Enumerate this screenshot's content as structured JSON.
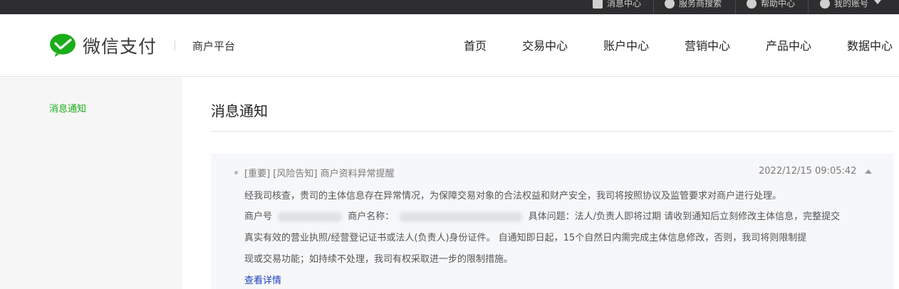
{
  "topbar": {
    "items": [
      {
        "label": "消息中心",
        "icon": "message-icon"
      },
      {
        "label": "服务商搜索",
        "icon": "search-icon"
      },
      {
        "label": "帮助中心",
        "icon": "help-icon"
      },
      {
        "label": "我的账号",
        "icon": "user-icon"
      }
    ]
  },
  "header": {
    "logo_text": "微信支付",
    "platform": "商户平台",
    "nav": [
      "首页",
      "交易中心",
      "账户中心",
      "营销中心",
      "产品中心",
      "数据中心"
    ]
  },
  "sidebar": {
    "items": [
      {
        "label": "消息通知",
        "active": true
      }
    ]
  },
  "main": {
    "title": "消息通知",
    "message": {
      "tag_important": "[重要]",
      "tag_risk": "[风险告知]",
      "subject": "商户资料异常提醒",
      "time": "2022/12/15 09:05:42",
      "line1": "经我司核查，贵司的主体信息存在异常情况，为保障交易对象的合法权益和财产安全，我司将按照协议及监管要求对商户进行处理。",
      "merchant_no_label": "商户号",
      "merchant_name_label": "商户名称：",
      "issue_text": "具体问题：法人/负责人即将过期 请收到通知后立刻修改主体信息，完整提交",
      "line3": "真实有效的营业执照/经营登记证书或法人(负责人)身份证件。 自通知即日起，15个自然日内需完成主体信息修改，否则，我司将则限制提",
      "line4": "现或交易功能；如持续不处理，我司有权采取进一步的限制措施。",
      "detail_link": "查看详情"
    }
  },
  "colors": {
    "brand_green": "#1aad19",
    "topbar_bg": "#2e2e30",
    "link_blue": "#1e3fbf",
    "card_bg": "#f6f7f9",
    "sidebar_bg": "#f6f6f6"
  }
}
